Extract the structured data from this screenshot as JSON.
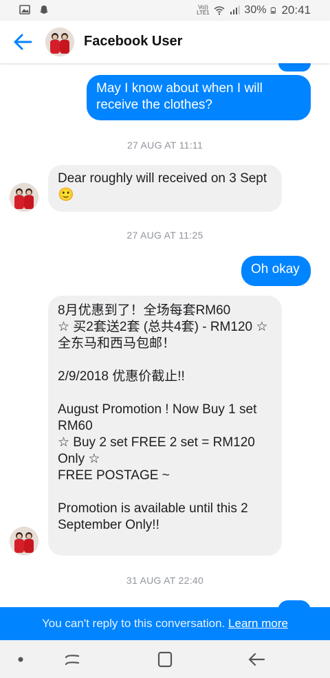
{
  "status_bar": {
    "battery": "30%",
    "time": "20:41",
    "network": "Vo)) LTE1"
  },
  "header": {
    "contact_name": "Facebook User"
  },
  "messages": [
    {
      "type": "out",
      "text": "May I know about when I will receive the clothes?"
    },
    {
      "type": "timestamp",
      "text": "27 AUG AT 11:11"
    },
    {
      "type": "in",
      "text": "Dear roughly will received on 3 Sept 🙂"
    },
    {
      "type": "timestamp",
      "text": "27 AUG AT 11:25"
    },
    {
      "type": "out",
      "text": "Oh okay"
    },
    {
      "type": "in",
      "text": "8月优惠到了！全场每套RM60\n☆ 买2套送2套 (总共4套) - RM120 ☆\n全东马和西马包邮！\n\n2/9/2018 优惠价截止!!\n\nAugust Promotion ! Now Buy 1 set RM60\n☆ Buy 2 set FREE 2 set = RM120 Only ☆\nFREE POSTAGE  ~\n\nPromotion is available until this 2 September Only!!"
    },
    {
      "type": "timestamp",
      "text": "31 AUG AT 22:40"
    }
  ],
  "footer": {
    "notice": "You can't reply to this conversation.",
    "link": "Learn more"
  },
  "colors": {
    "accent": "#0084ff",
    "incoming_bubble": "#f1f0f0",
    "timestamp": "#90949c"
  }
}
